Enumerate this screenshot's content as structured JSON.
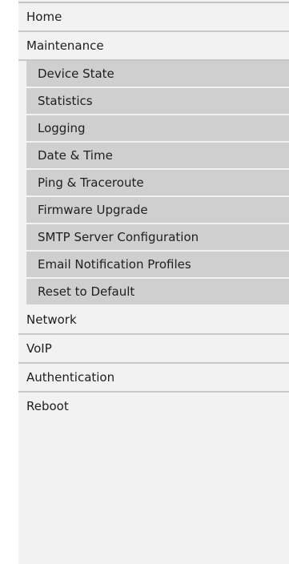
{
  "menu": {
    "home": "Home",
    "maintenance": {
      "label": "Maintenance",
      "children": [
        "Device State",
        "Statistics",
        "Logging",
        "Date & Time",
        "Ping & Traceroute",
        "Firmware Upgrade",
        "SMTP Server Configuration",
        "Email Notification Profiles",
        "Reset to Default"
      ]
    },
    "network": "Network",
    "voip": "VoIP",
    "authentication": "Authentication",
    "reboot": "Reboot"
  },
  "colors": {
    "panel_background": "#f2f2f2",
    "submenu_background": "#cfcfcf",
    "divider": "#c7c7c7",
    "text": "#202020"
  }
}
